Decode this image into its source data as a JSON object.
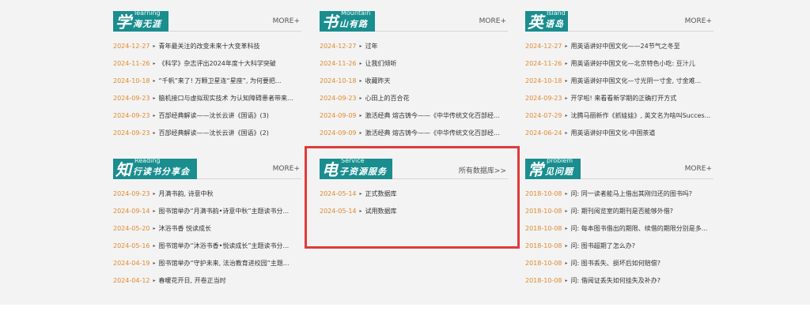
{
  "panels": {
    "learning": {
      "logo_big": "学",
      "logo_en": "learning",
      "logo_cn": "海无涯",
      "more": "MORE+",
      "items": [
        {
          "date": "2024-12-27",
          "title": "青年最关注的改变未来十大变革科技"
        },
        {
          "date": "2024-11-26",
          "title": "《科学》杂志评出2024年度十大科学突破"
        },
        {
          "date": "2024-10-18",
          "title": "“千帆”来了! 万颗卫星连“星座”, 为何要把..."
        },
        {
          "date": "2024-09-23",
          "title": "脑机接口与虚拟现实技术 为认知障碍患者带来..."
        },
        {
          "date": "2024-09-23",
          "title": "百部经典解读——沈长云讲《国语》(3)"
        },
        {
          "date": "2024-09-23",
          "title": "百部经典解读——沈长云讲《国语》(2)"
        }
      ]
    },
    "mountain": {
      "logo_big": "书",
      "logo_en": "Mountain",
      "logo_cn": "山有路",
      "more": "MORE+",
      "items": [
        {
          "date": "2024-12-27",
          "title": "过年"
        },
        {
          "date": "2024-11-26",
          "title": "让我们倾听"
        },
        {
          "date": "2024-10-18",
          "title": "收藏昨天"
        },
        {
          "date": "2024-09-23",
          "title": "心田上的百合花"
        },
        {
          "date": "2024-09-09",
          "title": "激活经典 熔古铸今——《中华传统文化百部经..."
        },
        {
          "date": "2024-09-09",
          "title": "激活经典 熔古铸今——《中华传统文化百部经..."
        }
      ]
    },
    "island": {
      "logo_big": "英",
      "logo_en": "Island",
      "logo_cn": "语岛",
      "more": "MORE+",
      "items": [
        {
          "date": "2024-12-27",
          "title": "用英语讲好中国文化——24节气之冬至"
        },
        {
          "date": "2024-11-26",
          "title": "用英语讲好中国文化—北京特色小吃: 豆汁儿"
        },
        {
          "date": "2024-10-18",
          "title": "用英语讲好中国文化—寸光阴一寸金, 寸金难..."
        },
        {
          "date": "2024-09-23",
          "title": "开学啦! 来看看新学期的正确打开方式"
        },
        {
          "date": "2024-07-29",
          "title": "沈腾马丽新作《抓娃娃》, 英文名为啥叫Succes..."
        },
        {
          "date": "2024-06-24",
          "title": "用英语讲好中国文化-中国茶道"
        }
      ]
    },
    "reading": {
      "logo_big": "知",
      "logo_en": "Reading",
      "logo_cn": "行读书分享会",
      "more": "MORE+",
      "items": [
        {
          "date": "2024-09-23",
          "title": "月满书韵, 诗意中秋"
        },
        {
          "date": "2024-09-14",
          "title": "图书馆举办“月满书韵•诗意中秋”主题读书分..."
        },
        {
          "date": "2024-05-20",
          "title": "沐浴书香 悦读成长"
        },
        {
          "date": "2024-05-16",
          "title": "图书馆举办“沐浴书香•悦读成长”主题读书分..."
        },
        {
          "date": "2024-04-19",
          "title": "图书馆举办“守护未来, 法治教育进校园”主题..."
        },
        {
          "date": "2024-04-12",
          "title": "春暖花开日, 开卷正当时"
        }
      ]
    },
    "service": {
      "logo_big": "电",
      "logo_en": "Service",
      "logo_cn": "子资源服务",
      "more": "所有数据库>>",
      "items": [
        {
          "date": "2024-05-14",
          "title": "正式数据库"
        },
        {
          "date": "2024-05-14",
          "title": "试用数据库"
        }
      ]
    },
    "problem": {
      "logo_big": "常",
      "logo_en": "problem",
      "logo_cn": "见问题",
      "more": "MORE+",
      "items": [
        {
          "date": "2018-10-08",
          "title": "问: 同一读者能马上借出其刚归还的图书吗?"
        },
        {
          "date": "2018-10-08",
          "title": "问: 期刊阅览室的期刊是否能够外借?"
        },
        {
          "date": "2018-10-08",
          "title": "问: 每本图书借出的期限、续借的期限分别是多..."
        },
        {
          "date": "2018-10-08",
          "title": "问: 图书超期了怎么办?"
        },
        {
          "date": "2018-10-08",
          "title": "问: 图书丢失、损坏后如何赔偿?"
        },
        {
          "date": "2018-10-08",
          "title": "问: 借阅证丢失如何挂失及补办?"
        }
      ]
    }
  },
  "colors": {
    "logo_bg": "#1a8d8f",
    "date": "#e08a2e",
    "highlight_border": "#e03a3a",
    "page_bg": "#f3f3f3"
  }
}
